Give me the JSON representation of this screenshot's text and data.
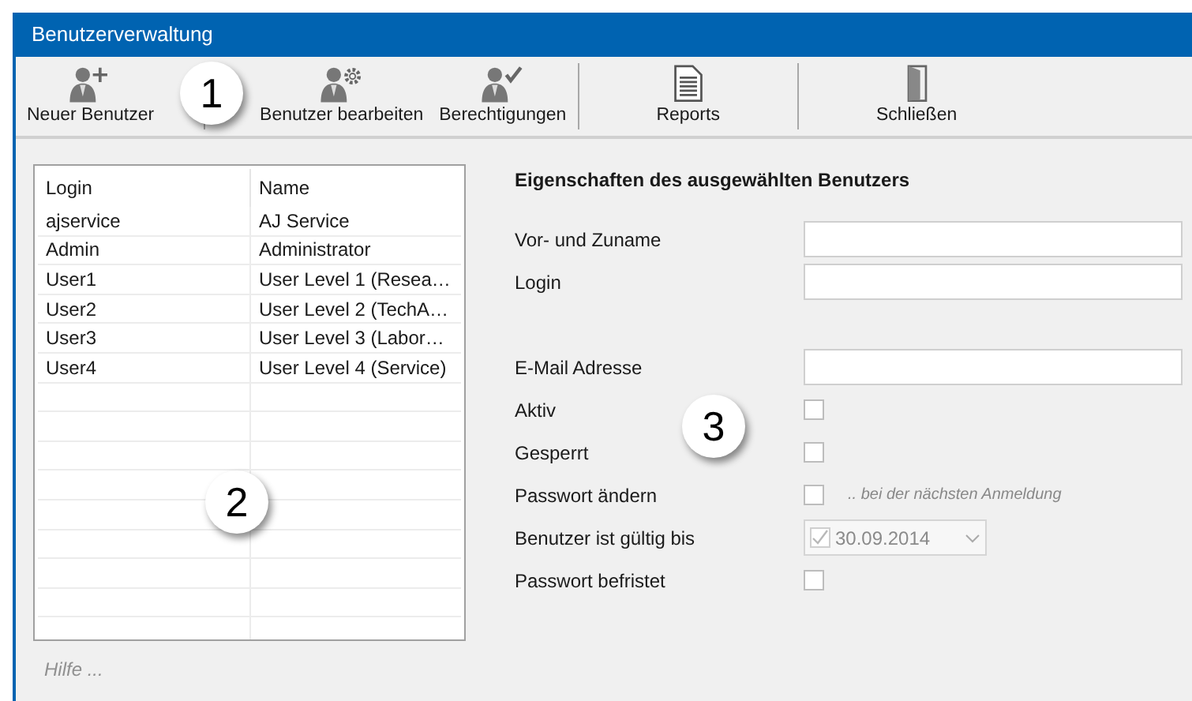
{
  "window": {
    "title": "Benutzerverwaltung"
  },
  "toolbar": {
    "groups": [
      [
        {
          "kind": "add-user",
          "label": "Neuer Benutzer"
        }
      ],
      [
        {
          "kind": "edit-user",
          "label": "Benutzer bearbeiten"
        },
        {
          "kind": "permissions",
          "label": "Berechtigungen"
        }
      ],
      [
        {
          "kind": "report",
          "label": "Reports"
        }
      ],
      [
        {
          "kind": "close",
          "label": "Schließen"
        }
      ]
    ]
  },
  "table": {
    "columns": [
      "Login",
      "Name"
    ],
    "rows": [
      [
        "ajservice",
        "AJ Service"
      ],
      [
        "Admin",
        "Administrator"
      ],
      [
        "User1",
        "User Level 1 (Resea…"
      ],
      [
        "User2",
        "User Level 2 (TechA…"
      ],
      [
        "User3",
        "User Level 3 (Labor…"
      ],
      [
        "User4",
        "User Level 4 (Service)"
      ]
    ]
  },
  "help": "Hilfe ...",
  "properties": {
    "title": "Eigenschaften des ausgewählten Benutzers",
    "groups": [
      [
        {
          "kind": "text",
          "label": "Vor- und Zuname"
        },
        {
          "kind": "text",
          "label": "Login"
        }
      ],
      [
        {
          "kind": "text",
          "label": "E-Mail Adresse"
        },
        {
          "kind": "checkbox",
          "label": "Aktiv",
          "checked": false
        },
        {
          "kind": "checkbox",
          "label": "Gesperrt",
          "checked": false
        },
        {
          "kind": "checkbox",
          "label": "Passwort ändern",
          "checked": false,
          "note": ".. bei der nächsten Anmeldung"
        },
        {
          "kind": "date",
          "label": "Benutzer ist gültig bis",
          "checked": true,
          "value": "30.09.2014",
          "disabled": true
        },
        {
          "kind": "checkbox",
          "label": "Passwort befristet",
          "checked": false
        }
      ]
    ]
  },
  "callouts": [
    "1",
    "2",
    "3"
  ]
}
